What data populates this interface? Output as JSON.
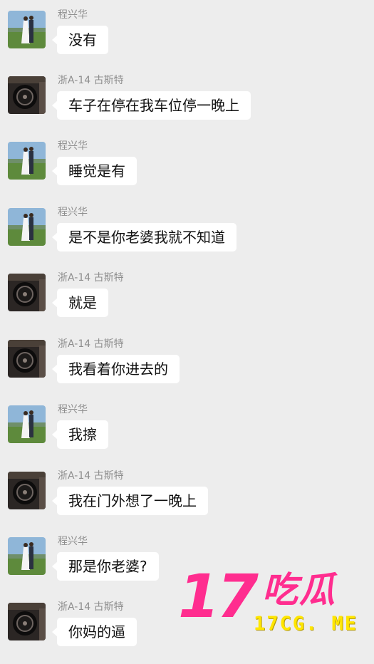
{
  "colors": {
    "background": "#ededed",
    "bubble": "#ffffff",
    "sender_name": "#8e8e8e",
    "watermark_pink": "#ff2d8f",
    "watermark_yellow": "#ffe600"
  },
  "messages": [
    {
      "sender": "程兴华",
      "avatar": "couple-photo-avatar",
      "text": "没有"
    },
    {
      "sender": "浙A-14 古斯特",
      "avatar": "dark-car-avatar",
      "text": "车子在停在我车位停一晚上"
    },
    {
      "sender": "程兴华",
      "avatar": "couple-photo-avatar",
      "text": "睡觉是有"
    },
    {
      "sender": "程兴华",
      "avatar": "couple-photo-avatar",
      "text": "是不是你老婆我就不知道"
    },
    {
      "sender": "浙A-14 古斯特",
      "avatar": "dark-car-avatar",
      "text": "就是"
    },
    {
      "sender": "浙A-14 古斯特",
      "avatar": "dark-car-avatar",
      "text": "我看着你进去的"
    },
    {
      "sender": "程兴华",
      "avatar": "couple-photo-avatar",
      "text": "我擦"
    },
    {
      "sender": "浙A-14 古斯特",
      "avatar": "dark-car-avatar",
      "text": "我在门外想了一晚上"
    },
    {
      "sender": "程兴华",
      "avatar": "couple-photo-avatar",
      "text": "那是你老婆?"
    },
    {
      "sender": "浙A-14 古斯特",
      "avatar": "dark-car-avatar",
      "text": "你妈的逼"
    }
  ],
  "watermark": {
    "number": "17",
    "brand": "吃瓜",
    "domain": "17CG. ME"
  }
}
